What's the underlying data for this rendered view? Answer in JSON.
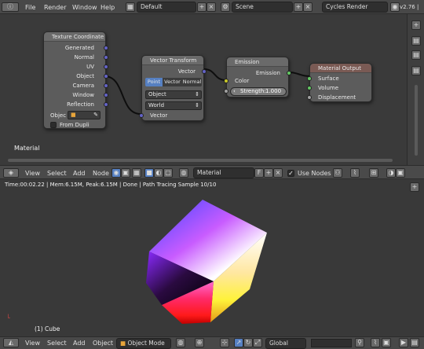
{
  "top_bar": {
    "menus": [
      "File",
      "Render",
      "Window",
      "Help"
    ],
    "screen_layout": "Default",
    "scene": "Scene",
    "render_engine": "Cycles Render",
    "version": "v2.76 |"
  },
  "nodes": {
    "texcoord": {
      "title": "Texture Coordinate",
      "outputs": [
        "Generated",
        "Normal",
        "UV",
        "Object",
        "Camera",
        "Window",
        "Reflection"
      ],
      "object_label": "Objec",
      "from_dupli": "From Dupli"
    },
    "vector_transform": {
      "title": "Vector Transform",
      "output": "Vector",
      "type_options": [
        "Point",
        "Vector",
        "Normal"
      ],
      "type_selected": "Point",
      "convert_from": "Object",
      "convert_to": "World",
      "input": "Vector"
    },
    "emission": {
      "title": "Emission",
      "output": "Emission",
      "color_input": "Color",
      "strength_label": "Strength:",
      "strength_value": "1.000"
    },
    "material_output": {
      "title": "Material Output",
      "inputs": [
        "Surface",
        "Volume",
        "Displacement"
      ]
    },
    "material_label": "Material"
  },
  "node_header": {
    "menus": [
      "View",
      "Select",
      "Add",
      "Node"
    ],
    "material_name": "Material",
    "fake_user": "F",
    "use_nodes_label": "Use Nodes"
  },
  "viewport": {
    "status": "Time:00:02.22 | Mem:6.15M, Peak:6.15M | Done | Path Tracing Sample 10/10",
    "object_label": "(1) Cube"
  },
  "bottom_bar": {
    "menus": [
      "View",
      "Select",
      "Add",
      "Object"
    ],
    "mode": "Object Mode",
    "orientation": "Global"
  },
  "colors": {
    "vector_socket": "#6363c7",
    "color_socket": "#c7c729",
    "float_socket": "#a1a1a1",
    "shader_socket": "#63c763",
    "selected_blue": "#5680c2"
  }
}
